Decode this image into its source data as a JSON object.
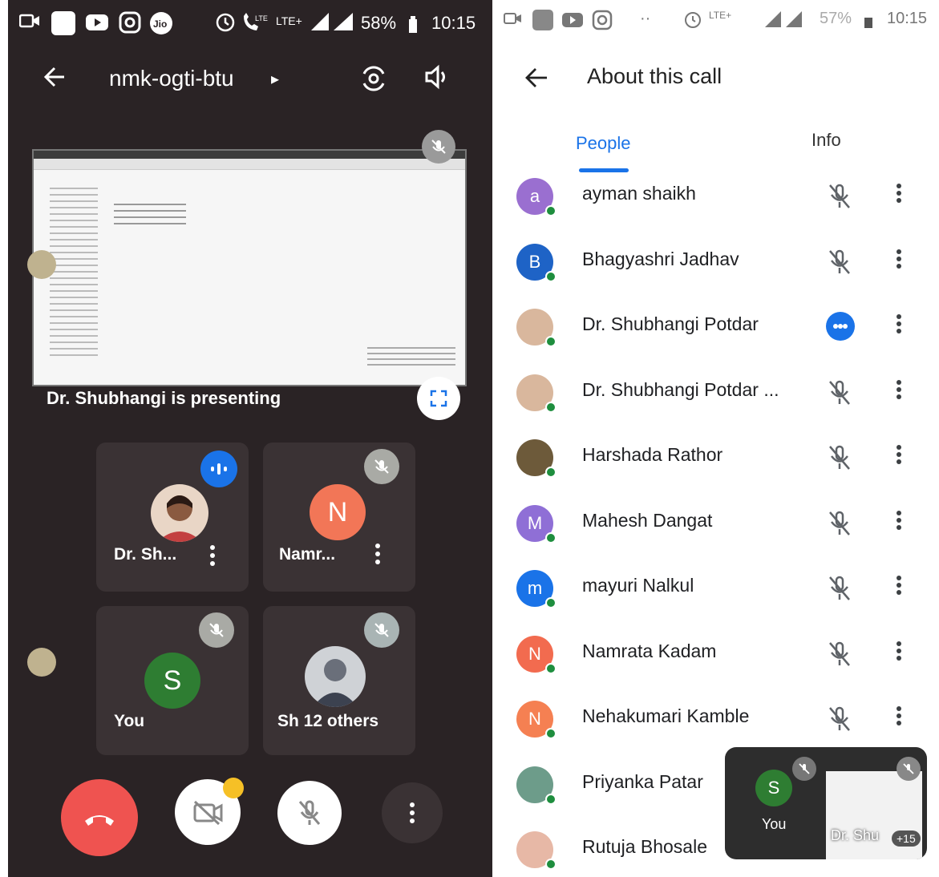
{
  "left_phone": {
    "status": {
      "battery": "58%",
      "time": "10:15",
      "network": "LTE+"
    },
    "topbar": {
      "meeting_code": "nmk-ogti-btu"
    },
    "presenting_text": "Dr. Shubhangi is presenting",
    "tiles": [
      {
        "name": "Dr. Sh...",
        "initial": ""
      },
      {
        "name": "Namr...",
        "initial": "N",
        "color": "#f27657"
      },
      {
        "name": "You",
        "initial": "S",
        "color": "#2e7d32"
      },
      {
        "name": "Sh 12 others",
        "initial": ""
      }
    ],
    "colors": {
      "end_call": "#ef5350",
      "background": "#2a2325"
    }
  },
  "right_phone": {
    "status": {
      "battery": "57%",
      "time": "10:15",
      "network": "LTE+"
    },
    "header": {
      "title": "About this call"
    },
    "tabs": [
      {
        "label": "People",
        "active": true
      },
      {
        "label": "Info",
        "active": false
      }
    ],
    "participants": [
      {
        "name": "ayman shaikh",
        "initial": "a",
        "color": "#9a6fd0",
        "state": "muted"
      },
      {
        "name": "Bhagyashri Jadhav",
        "initial": "B",
        "color": "#1e63c6",
        "state": "muted"
      },
      {
        "name": "Dr. Shubhangi Potdar",
        "initial": "",
        "color": "#d9b79d",
        "state": "speaking"
      },
      {
        "name": "Dr. Shubhangi Potdar ...",
        "initial": "",
        "color": "#d9b79d",
        "state": "muted"
      },
      {
        "name": "Harshada Rathor",
        "initial": "",
        "color": "#6d5a3a",
        "state": "muted"
      },
      {
        "name": "Mahesh Dangat",
        "initial": "M",
        "color": "#8f6fd6",
        "state": "muted"
      },
      {
        "name": "mayuri Nalkul",
        "initial": "m",
        "color": "#1a73e8",
        "state": "muted"
      },
      {
        "name": "Namrata Kadam",
        "initial": "N",
        "color": "#f26b4f",
        "state": "muted"
      },
      {
        "name": "Nehakumari Kamble",
        "initial": "N",
        "color": "#f58052",
        "state": "muted"
      },
      {
        "name": "Priyanka Patar",
        "initial": "",
        "color": "#6d9c8a",
        "state": "muted"
      },
      {
        "name": "Rutuja Bhosale",
        "initial": "",
        "color": "#e7b8a6",
        "state": "muted"
      }
    ],
    "pip": {
      "self_initial": "S",
      "self_label": "You",
      "other_label": "Dr. Shu",
      "more_count": "+15"
    }
  }
}
